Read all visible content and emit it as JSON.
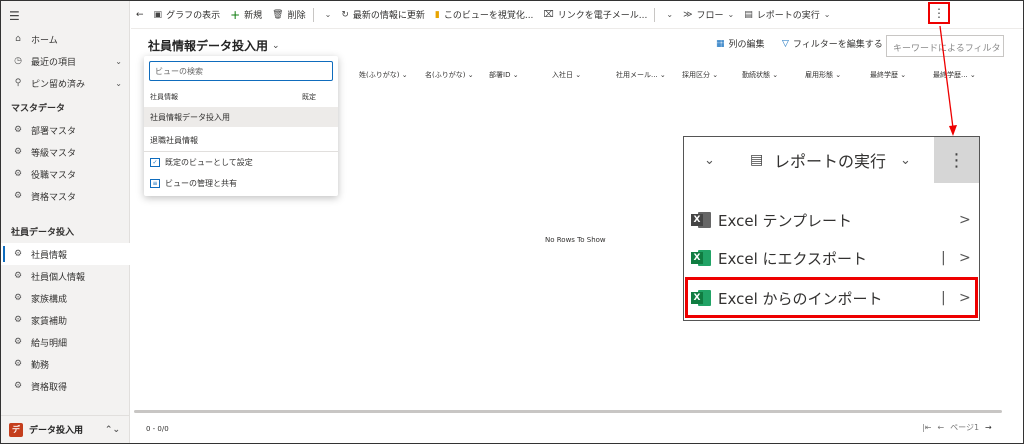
{
  "sidebar": {
    "top_items": [
      {
        "icon": "home-icon",
        "glyph": "⌂",
        "label": "ホーム",
        "chevron": false
      },
      {
        "icon": "clock-icon",
        "glyph": "◷",
        "label": "最近の項目",
        "chevron": true
      },
      {
        "icon": "pin-icon",
        "glyph": "⚲",
        "label": "ピン留め済み",
        "chevron": true
      }
    ],
    "section1_title": "マスタデータ",
    "section1_items": [
      "部署マスタ",
      "等級マスタ",
      "役職マスタ",
      "資格マスタ"
    ],
    "section2_title": "社員データ投入",
    "section2_items": [
      "社員情報",
      "社員個人情報",
      "家族構成",
      "家賃補助",
      "給与明細",
      "勤務",
      "資格取得"
    ],
    "active_item": "社員情報",
    "area_badge": "デ",
    "area_label": "データ投入用"
  },
  "commandbar": {
    "back": "←",
    "show_chart": "グラフの表示",
    "new": "新規",
    "delete": "削除",
    "refresh": "最新の情報に更新",
    "visualize": "このビューを視覚化...",
    "email_link": "リンクを電子メール...",
    "flow": "フロー",
    "run_report": "レポートの実行",
    "more": "⋮"
  },
  "view": {
    "title": "社員情報データ投入用",
    "edit_columns": "列の編集",
    "edit_filters": "フィルターを編集する",
    "keyword_search_placeholder": "キーワードによるフィルタ"
  },
  "columns": [
    "姓(ふりがな)",
    "名(ふりがな)",
    "部署ID",
    "入社日",
    "社用メール...",
    "採用区分",
    "勤続状態",
    "雇用形態",
    "最終学歴",
    "最終学歴..."
  ],
  "grid": {
    "empty_message": "No Rows To Show",
    "count": "0 - 0/0",
    "page_label": "ページ1"
  },
  "view_dropdown": {
    "search_placeholder": "ビューの検索",
    "group_label": "社員情報",
    "default_label": "既定",
    "items": [
      "社員情報データ投入用",
      "退職社員情報"
    ],
    "actions": [
      "既定のビューとして設定",
      "ビューの管理と共有"
    ]
  },
  "callout": {
    "run_report": "レポートの実行",
    "more": "⋮",
    "items": [
      {
        "label": "Excel テンプレート",
        "bar": false
      },
      {
        "label": "Excel にエクスポート",
        "bar": true
      },
      {
        "label": "Excel からのインポート",
        "bar": true
      }
    ]
  },
  "colors": {
    "accent": "#0f6cbd",
    "highlight": "#ee0000",
    "excel_green": "#107c41"
  }
}
